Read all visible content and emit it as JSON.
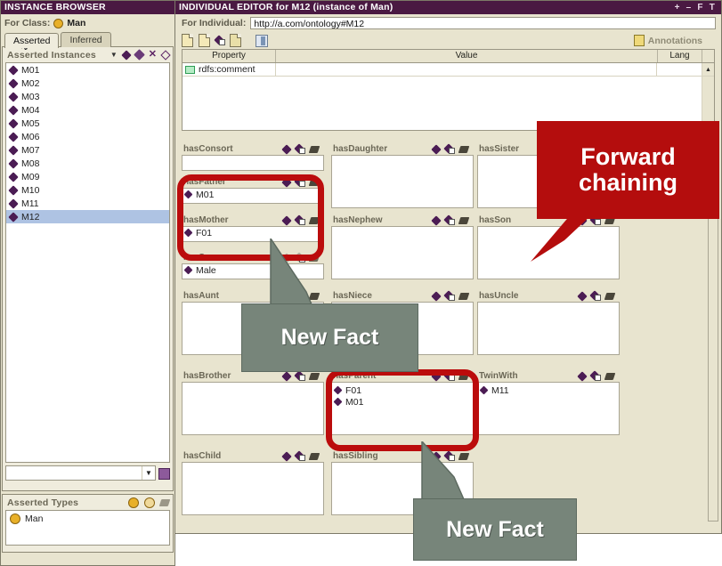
{
  "browser": {
    "title": "INSTANCE BROWSER",
    "for_class_label": "For Class:",
    "class_name": "Man",
    "tabs": [
      {
        "label": "Asserted",
        "active": true
      },
      {
        "label": "Inferred",
        "active": false
      }
    ],
    "asserted_instances_label": "Asserted Instances",
    "instances": [
      {
        "name": "M01",
        "selected": false
      },
      {
        "name": "M02",
        "selected": false
      },
      {
        "name": "M03",
        "selected": false
      },
      {
        "name": "M04",
        "selected": false
      },
      {
        "name": "M05",
        "selected": false
      },
      {
        "name": "M06",
        "selected": false
      },
      {
        "name": "M07",
        "selected": false
      },
      {
        "name": "M08",
        "selected": false
      },
      {
        "name": "M09",
        "selected": false
      },
      {
        "name": "M10",
        "selected": false
      },
      {
        "name": "M11",
        "selected": false
      },
      {
        "name": "M12",
        "selected": true
      }
    ],
    "filter_value": "",
    "asserted_types_label": "Asserted Types",
    "asserted_types": [
      {
        "name": "Man"
      }
    ]
  },
  "editor": {
    "title": "INDIVIDUAL EDITOR for M12   (instance of Man)",
    "window_controls": [
      "+",
      "–",
      "F",
      "T"
    ],
    "for_individual_label": "For Individual:",
    "individual_uri": "http://a.com/ontology#M12",
    "annotations_label": "Annotations",
    "property_table": {
      "columns": [
        "Property",
        "Value",
        "Lang"
      ],
      "rows": [
        {
          "property": "rdfs:comment",
          "value": "",
          "lang": ""
        }
      ]
    },
    "properties": [
      {
        "name": "hasConsort",
        "values": [],
        "col": 0,
        "row": 0,
        "tall": false,
        "dim": false
      },
      {
        "name": "hasFather",
        "values": [
          "M01"
        ],
        "col": 0,
        "row": 1,
        "tall": false,
        "dim": false
      },
      {
        "name": "hasMother",
        "values": [
          "F01"
        ],
        "col": 0,
        "row": 2,
        "tall": false,
        "dim": false
      },
      {
        "name": "hasSex",
        "values": [
          "Male"
        ],
        "col": 0,
        "row": 3,
        "tall": false,
        "dim": true
      },
      {
        "name": "hasDaughter",
        "values": [],
        "col": 1,
        "row": 0,
        "tall": true,
        "dim": false
      },
      {
        "name": "hasNephew",
        "values": [],
        "col": 1,
        "row": 2,
        "tall": true,
        "dim": false
      },
      {
        "name": "hasSister",
        "values": [],
        "col": 2,
        "row": 0,
        "tall": true,
        "dim": false
      },
      {
        "name": "hasSon",
        "values": [],
        "col": 2,
        "row": 2,
        "tall": true,
        "dim": false
      },
      {
        "name": "hasAunt",
        "values": [],
        "col": 0,
        "row": 4,
        "tall": true,
        "dim": false
      },
      {
        "name": "hasNiece",
        "values": [],
        "col": 1,
        "row": 4,
        "tall": true,
        "dim": false
      },
      {
        "name": "hasUncle",
        "values": [],
        "col": 2,
        "row": 4,
        "tall": true,
        "dim": false
      },
      {
        "name": "hasBrother",
        "values": [],
        "col": 0,
        "row": 5,
        "tall": true,
        "dim": false
      },
      {
        "name": "hasParent",
        "values": [
          "F01",
          "M01"
        ],
        "col": 1,
        "row": 5,
        "tall": true,
        "dim": false
      },
      {
        "name": "TwinWith",
        "values": [
          "M11"
        ],
        "col": 2,
        "row": 5,
        "tall": true,
        "dim": false
      },
      {
        "name": "hasChild",
        "values": [],
        "col": 0,
        "row": 6,
        "tall": true,
        "dim": false
      },
      {
        "name": "hasSibling",
        "values": [],
        "col": 1,
        "row": 6,
        "tall": true,
        "dim": false
      }
    ]
  },
  "annotations": {
    "forward_chaining": "Forward chaining",
    "new_fact_1": "New Fact",
    "new_fact_2": "New Fact",
    "colors": {
      "highlight_ring": "#bb0c0c",
      "callout_red": "#b40d0d",
      "callout_gray": "#77857a",
      "titlebar": "#4a1942",
      "panel_bg": "#e8e4cf",
      "selection": "#aec3e3"
    }
  }
}
